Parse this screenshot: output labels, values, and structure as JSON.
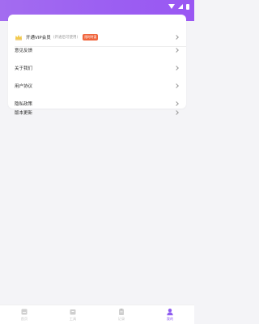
{
  "colors": {
    "accent": "#8e5cf0",
    "header_gradient_start": "#a36cf0",
    "header_gradient_end": "#9a57f3",
    "badge": "#f0643c",
    "vip_icon": "#f2c94c",
    "tab_inactive": "#c4c4c4"
  },
  "menu": {
    "vip": {
      "icon": "crown-icon",
      "label": "开通VIP会员",
      "sub": "(开通后可使用)",
      "badge": "限时特惠"
    },
    "items": [
      {
        "label": "意见反馈"
      },
      {
        "label": "关于我们"
      },
      {
        "label": "用户协议"
      },
      {
        "label": "隐私政策"
      },
      {
        "label": "版本更新"
      }
    ]
  },
  "tabbar": {
    "tabs": [
      {
        "label": "首页",
        "icon": "home-icon",
        "active": false
      },
      {
        "label": "工具",
        "icon": "toolbox-icon",
        "active": false
      },
      {
        "label": "记录",
        "icon": "clipboard-icon",
        "active": false
      },
      {
        "label": "我的",
        "icon": "person-icon",
        "active": true
      }
    ]
  }
}
